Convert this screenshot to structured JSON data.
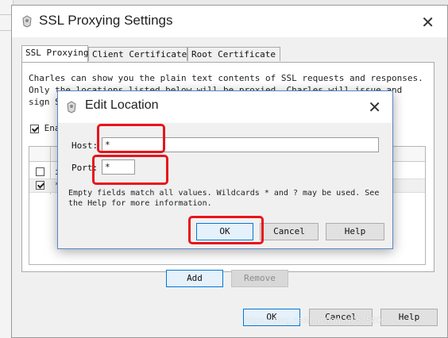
{
  "main_dialog": {
    "title": "SSL Proxying Settings",
    "tabs": [
      {
        "label": "SSL Proxying",
        "active": true
      },
      {
        "label": "Client Certificates",
        "active": false
      },
      {
        "label": "Root Certificate",
        "active": false
      }
    ],
    "description": "Charles can show you the plain text contents of SSL requests and responses. Only the locations listed below will be proxied. Charles will issue and sign SSL certif",
    "enable_label": "Ena",
    "enable_checked": true,
    "locations": [
      {
        "checked": false,
        "host": "i"
      },
      {
        "checked": true,
        "host": "*"
      }
    ],
    "add_label": "Add",
    "remove_label": "Remove",
    "ok_label": "OK",
    "cancel_label": "Cancel",
    "help_label": "Help"
  },
  "edit_dialog": {
    "title": "Edit Location",
    "host_label": "Host:",
    "host_value": "*",
    "port_label": "Port:",
    "port_value": "*",
    "hint": "Empty fields match all values. Wildcards * and ? may be used. See the Help for more information.",
    "ok_label": "OK",
    "cancel_label": "Cancel",
    "help_label": "Help"
  },
  "watermark": "https://blog.csdn.net/qq_40585805",
  "colors": {
    "highlight": "#e8141b",
    "focus_blue": "#0078d7",
    "dialog_bg": "#f0f0f0"
  },
  "icons": {
    "window": "app-icon",
    "close": "close-icon"
  }
}
